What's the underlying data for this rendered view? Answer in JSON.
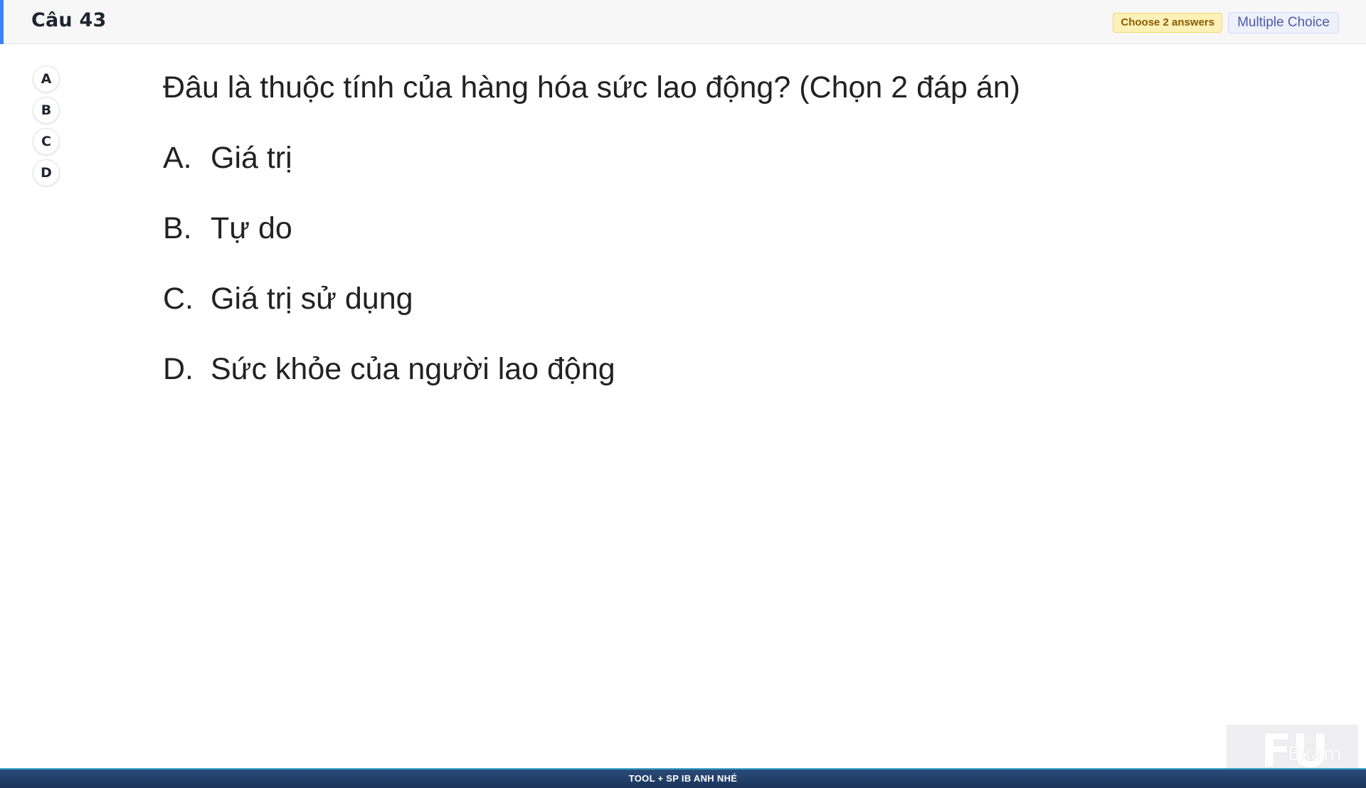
{
  "header": {
    "question_number": "Câu 43",
    "choose_badge": "Choose 2 answers",
    "type_badge": "Multiple Choice",
    "accent_color": "#3b82f6"
  },
  "selectors": [
    "A",
    "B",
    "C",
    "D"
  ],
  "question": {
    "text": "Đâu là thuộc tính của hàng hóa sức lao động? (Chọn 2 đáp án)",
    "options": [
      {
        "letter": "A.",
        "text": "Giá trị"
      },
      {
        "letter": "B.",
        "text": "Tự do"
      },
      {
        "letter": "C.",
        "text": "Giá trị sử dụng"
      },
      {
        "letter": "D.",
        "text": "Sức khỏe của người lao động"
      }
    ]
  },
  "watermark": {
    "logo": "FU",
    "text": "Exam"
  },
  "footer": {
    "text": "TOOL + SP IB ANH NHÉ"
  }
}
